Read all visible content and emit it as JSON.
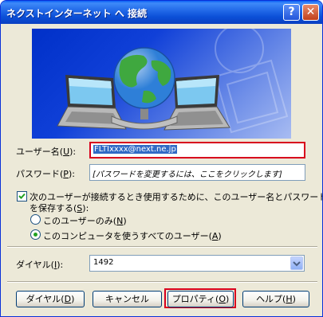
{
  "window": {
    "title": "ネクストインターネット へ 接続",
    "help_glyph": "?",
    "close_glyph": "✕"
  },
  "colors": {
    "titlebar": "#0A4FD7",
    "dialog_bg": "#ECE9D8",
    "highlight_box": "#D8001C",
    "selection": "#316AC5"
  },
  "form": {
    "username_label": "ユーザー名(",
    "username_key": "U",
    "username_close": "):",
    "username_value": "FLTIxxxx@next.ne.jp",
    "password_label": "パスワード(",
    "password_key": "P",
    "password_close": "):",
    "password_placeholder": "[パスワードを変更するには、ここをクリックします]",
    "save_checkbox_line1": "次のユーザーが接続するとき使用するために、このユーザー名とパスワード",
    "save_checkbox_line2a": "を保存する(",
    "save_checkbox_key": "S",
    "save_checkbox_line2b": "):",
    "radio_me_only": "このユーザーのみ(",
    "radio_me_only_key": "N",
    "radio_close": ")",
    "radio_all_users": "このコンピュータを使うすべてのユーザー(",
    "radio_all_users_key": "A",
    "save_checked": true,
    "selected_radio": "all_users",
    "dial_label": "ダイヤル(",
    "dial_key": "I",
    "dial_close": "):",
    "dial_value": "1492"
  },
  "buttons": {
    "dial_label": "ダイヤル(",
    "dial_key": "D",
    "cancel": "キャンセル",
    "properties_label": "プロパティ(",
    "properties_key": "O",
    "help_label": "ヘルプ(",
    "help_key": "H",
    "close_paren": ")"
  }
}
